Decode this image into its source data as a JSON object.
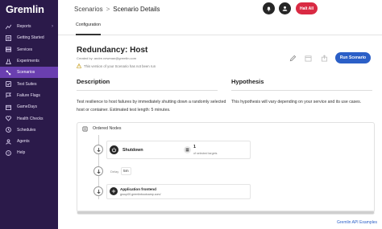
{
  "brand": {
    "name": "Gremlin"
  },
  "sidebar": {
    "items": [
      {
        "label": "Reports",
        "icon": "chart-icon",
        "chevron": "›",
        "active": false
      },
      {
        "label": "Getting Started",
        "icon": "list-icon",
        "active": false
      },
      {
        "label": "Services",
        "icon": "services-icon",
        "active": false
      },
      {
        "label": "Experiments",
        "icon": "flask-icon",
        "active": false
      },
      {
        "label": "Scenarios",
        "icon": "scenario-icon",
        "active": true
      },
      {
        "label": "Test Suites",
        "icon": "suite-icon",
        "active": false
      },
      {
        "label": "Failure Flags",
        "icon": "flag-icon",
        "active": false
      },
      {
        "label": "GameDays",
        "icon": "calendar-icon",
        "active": false
      },
      {
        "label": "Health Checks",
        "icon": "heart-icon",
        "active": false
      },
      {
        "label": "Schedules",
        "icon": "clock-icon",
        "active": false
      },
      {
        "label": "Agents",
        "icon": "agent-icon",
        "active": false
      },
      {
        "label": "Help",
        "icon": "help-icon",
        "active": false
      }
    ]
  },
  "header": {
    "breadcrumb_root": "Scenarios",
    "breadcrumb_sep": ">",
    "breadcrumb_current": "Scenario Details",
    "halt_label": "Halt All"
  },
  "tabs": [
    {
      "label": "Configuration",
      "active": true
    }
  ],
  "scenario": {
    "title": "Redundancy: Host",
    "created_by": "Created by: andre.newman@gremlin.com",
    "warning": "This version of your Scenario has not been run",
    "run_label": "Run Scenario"
  },
  "description": {
    "heading": "Description",
    "text": "Test resilience to host failures by immediately shutting down a randomly selected host or container. Estimated test length: 5 minutes."
  },
  "hypothesis": {
    "heading": "Hypothesis",
    "text": "This hypothesis will vary depending on your service and its use cases."
  },
  "nodes": {
    "label": "Ordered Nodes",
    "attack": {
      "name": "Shutdown",
      "target_count": "1",
      "target_sub": "of selected targets"
    },
    "delay": {
      "label": "Delay",
      "value": "5m"
    },
    "health_check": {
      "title": "Application frontend",
      "subtitle": "group00.gremlinbootcamp.com/"
    }
  },
  "footer": {
    "link": "Gremlin API Examples"
  },
  "colors": {
    "sidebar_bg": "#2b1a4a",
    "active": "#6a3fb0",
    "halt": "#d92a43",
    "run": "#2b5fc7"
  }
}
